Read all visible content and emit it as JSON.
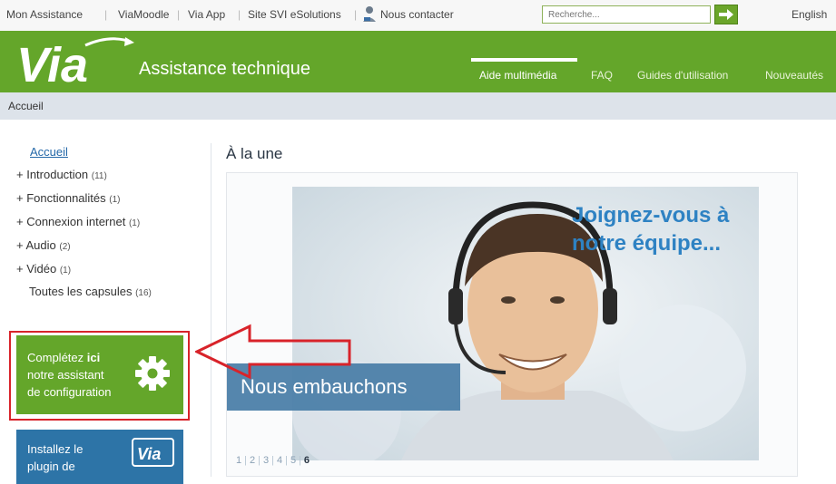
{
  "colors": {
    "brand_green": "#64a62a",
    "blue": "#2d74a7",
    "red": "#d8232a",
    "crumb_bg": "#dde3ea",
    "headline_blue": "#2e82c3"
  },
  "topbar": {
    "links": [
      "Mon Assistance",
      "ViaMoodle",
      "Via App",
      "Site SVI eSolutions",
      "Nous contacter"
    ],
    "contact_icon": "user-phone-icon",
    "search_placeholder": "Recherche...",
    "search_button_icon": "arrow-right-icon",
    "language": "English"
  },
  "header": {
    "logo_text": "Via",
    "title": "Assistance technique",
    "nav": [
      "Aide multimédia",
      "FAQ",
      "Guides d'utilisation",
      "Nouveautés"
    ],
    "active_nav": "Aide multimédia"
  },
  "breadcrumb": {
    "current": "Accueil"
  },
  "sidebar": {
    "home": "Accueil",
    "items": [
      {
        "label": "+ Introduction",
        "count": "(11)"
      },
      {
        "label": "+ Fonctionnalités",
        "count": "(1)"
      },
      {
        "label": "+ Connexion internet",
        "count": "(1)"
      },
      {
        "label": "+ Audio",
        "count": "(2)"
      },
      {
        "label": "+ Vidéo",
        "count": "(1)"
      }
    ],
    "all": {
      "label": "Toutes les capsules",
      "count": "(16)"
    },
    "config_box": {
      "line1_prefix": "Complétez ",
      "line1_bold": "ici",
      "line2": "notre assistant",
      "line3": "de configuration",
      "icon": "gear-icon"
    },
    "plugin_box": {
      "line1": "Installez le",
      "line2": "plugin de",
      "badge_text": "Via"
    }
  },
  "main": {
    "section_title": "À la une",
    "slide": {
      "headline_line1": "Joignez-vous à",
      "headline_line2": "notre équipe...",
      "banner": "Nous embauchons"
    },
    "pager": {
      "pages": [
        "1",
        "2",
        "3",
        "4",
        "5",
        "6"
      ],
      "active": "6"
    }
  }
}
